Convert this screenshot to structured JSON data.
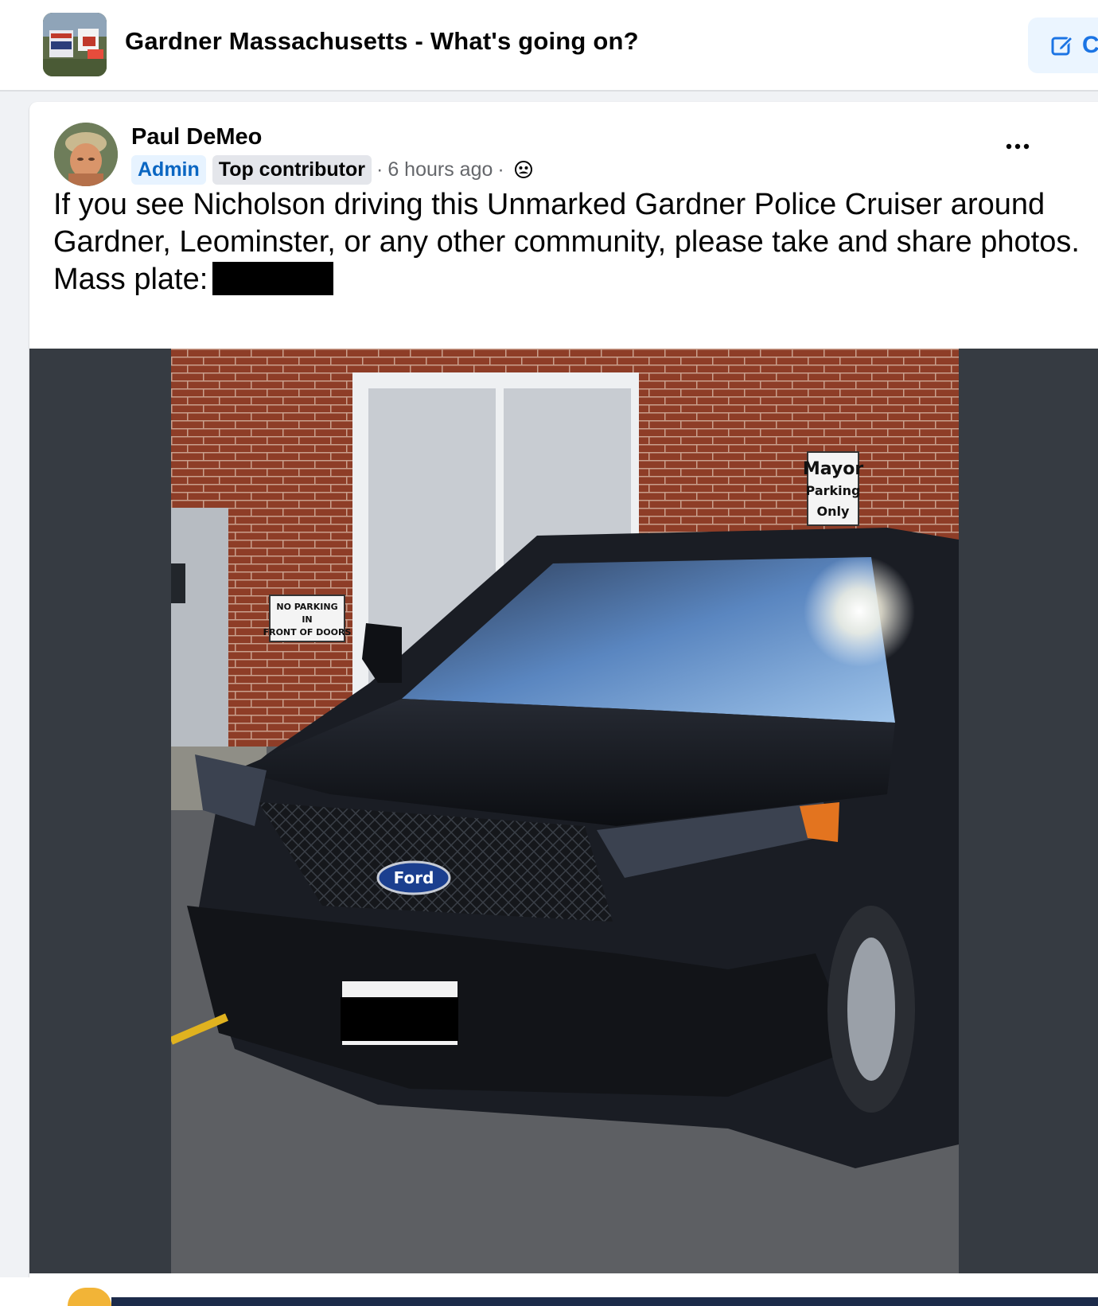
{
  "group": {
    "name": "Gardner Massachusetts - What's going on?",
    "thumb_icon": "group-photo-thumb",
    "create_label": "C"
  },
  "post": {
    "author": "Paul DeMeo",
    "badge_admin": "Admin",
    "badge_top": "Top contributor",
    "time": "6 hours ago",
    "audience_icon": "group-members-icon",
    "text": "If you see Nicholson driving this Unmarked Gardner Police Cruiser around Gardner, Leominster, or any other community, please take and share photos. Mass plate:",
    "photo": {
      "description_icon": "photo-black-ford-suv",
      "sign_mayor": [
        "Mayor",
        "Parking",
        "Only"
      ],
      "sign_no_parking": [
        "NO PARKING",
        "IN",
        "FRONT OF DOORS"
      ],
      "logo": "Ford"
    }
  },
  "colors": {
    "accent": "#1b74e4",
    "admin_badge": "#0a66c2",
    "page_bg": "#f0f2f5",
    "photo_letterbox": "#363b42"
  }
}
